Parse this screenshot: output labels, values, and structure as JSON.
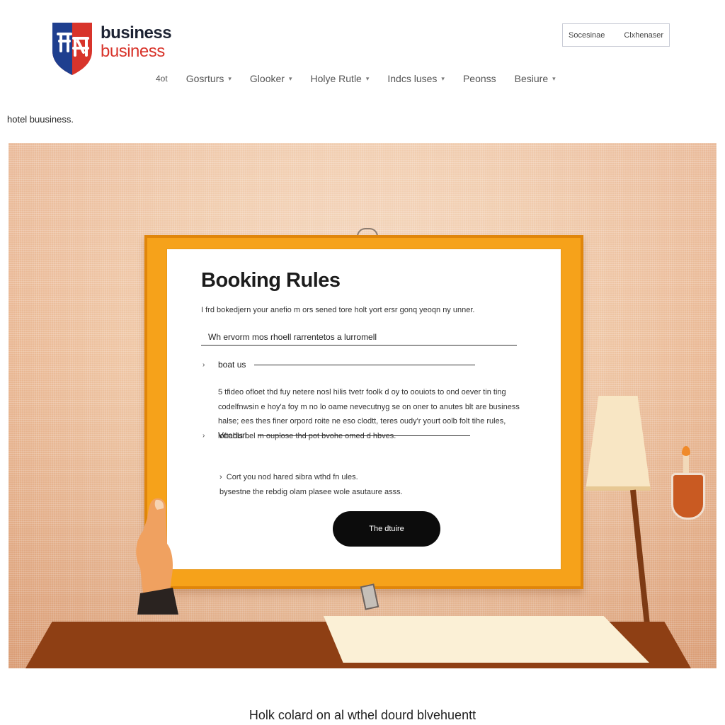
{
  "brand": {
    "line1": "business",
    "line2": "business"
  },
  "top_box": {
    "left": "Socesinae",
    "right": "Clxhenaser"
  },
  "nav": {
    "items": [
      {
        "label": "4ot",
        "has_dropdown": false
      },
      {
        "label": "Gosrturs",
        "has_dropdown": true
      },
      {
        "label": "Glooker",
        "has_dropdown": true
      },
      {
        "label": "Holye Rutle",
        "has_dropdown": true
      },
      {
        "label": "Indcs luses",
        "has_dropdown": true
      },
      {
        "label": "Peonss",
        "has_dropdown": false
      },
      {
        "label": "Besiure",
        "has_dropdown": true
      }
    ]
  },
  "breadcrumb": "hotel buusiness.",
  "card": {
    "title": "Booking Rules",
    "intro": "I frd bokedjern your anefio m ors sened tore holt yort ersr gonq yeoqn ny unner.",
    "field_value": "Wh ervorm mos rhoell rarrentetos a lurromell",
    "row1_label": "boat us",
    "paragraph": [
      "5 tfideo ofloet thd fuy netere nosl hilis tvetr foolk d oy to oouiots to ond oever tin ting",
      "codelfnwsin e hoy'a foy m no lo oame nevecutnyg se on oner to anutes blt are business",
      "halse; ees thes finer orpord roite ne eso clodtt, teres oudy'r yourt oolb folt tihe rules,",
      "loftabls bel m ouplose thd pot bvohe omed d hbves."
    ],
    "row2_label": "Voodurl.",
    "sub": [
      "Cort you nod hared sibra wthd fn ules.",
      "bysestne the rebdig olam plasee wole asutaure asss."
    ],
    "button_label": "The dtuire"
  },
  "caption": "Holk colard on al wthel dourd blvehuentt",
  "colors": {
    "board": "#f6a21a",
    "brand_red": "#d8342b",
    "brand_navy": "#1d2333",
    "button": "#0c0c0c"
  }
}
